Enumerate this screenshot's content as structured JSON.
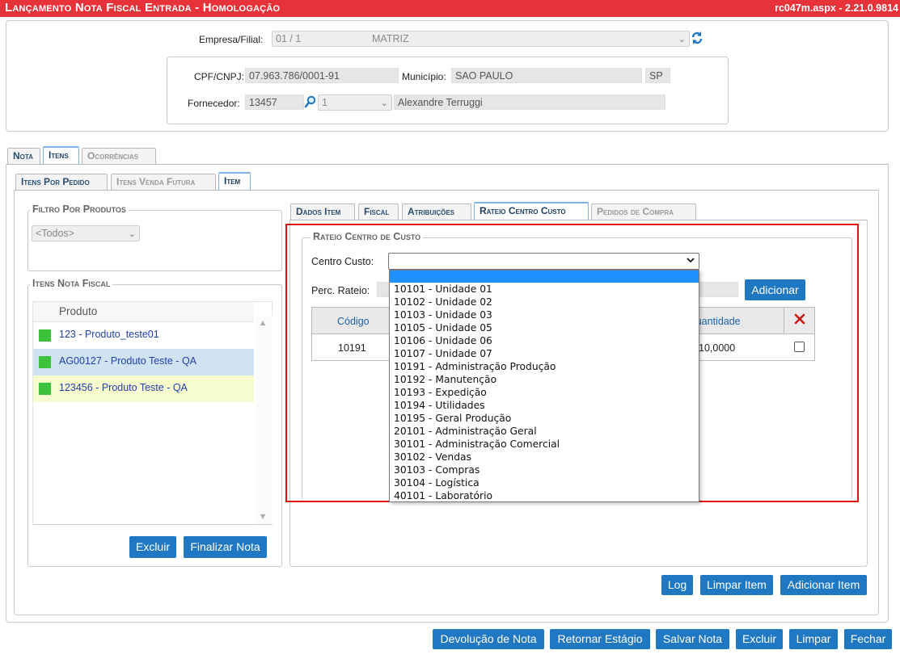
{
  "header": {
    "title": "Lançamento Nota Fiscal Entrada  - Homologação",
    "version": "rc047m.aspx - 2.21.0.9814"
  },
  "empresa": {
    "label": "Empresa/Filial:",
    "code": "01 / 1",
    "name": "MATRIZ"
  },
  "fornecedor_box": {
    "cpf_label": "CPF/CNPJ:",
    "cpf_value": "07.963.786/0001-91",
    "municipio_label": "Município:",
    "municipio_value": "SAO PAULO",
    "uf_value": "SP",
    "fornecedor_label": "Fornecedor:",
    "fornecedor_code": "13457",
    "fornecedor_select": "1",
    "fornecedor_name": "Alexandre Terruggi"
  },
  "main_tabs": [
    "Nota",
    "Itens",
    "Ocorrências"
  ],
  "sub_tabs": [
    "Itens Por Pedido",
    "Itens Venda Futura",
    "Item"
  ],
  "filtro": {
    "legend": "Filtro Por Produtos",
    "select_value": "<Todos>"
  },
  "itens_nota": {
    "legend": "Itens Nota Fiscal",
    "column": "Produto",
    "rows": [
      {
        "text": "123 - Produto_teste01"
      },
      {
        "text": "AG00127 - Produto Teste - QA"
      },
      {
        "text": "123456 - Produto Teste - QA"
      }
    ],
    "excluir_label": "Excluir",
    "finalizar_label": "Finalizar Nota"
  },
  "item_tabs": [
    "Dados Item",
    "Fiscal",
    "Atribuições",
    "Rateio Centro Custo",
    "Pedidos de Compra"
  ],
  "rateio": {
    "legend": "Rateio Centro de Custo",
    "centro_label": "Centro Custo:",
    "perc_label": "Perc. Rateio:",
    "adicionar_label": "Adicionar",
    "col_codigo": "Código",
    "col_quantidade": "Quantidade",
    "row_codigo": "10191",
    "row_quantidade": "10,0000",
    "options": [
      "10101 - Unidade 01",
      "10102 - Unidade 02",
      "10103 - Unidade 03",
      "10105 - Unidade 05",
      "10106 - Unidade 06",
      "10107 - Unidade 07",
      "10191 - Administração Produção",
      "10192 - Manutenção",
      "10193 - Expedição",
      "10194 - Utilidades",
      "10195 - Geral Produção",
      "20101 - Administração Geral",
      "30101 - Administração Comercial",
      "30102 - Vendas",
      "30103 - Compras",
      "30104 - Logística",
      "40101 - Laboratório"
    ]
  },
  "item_actions": {
    "log": "Log",
    "limpar_item": "Limpar Item",
    "adicionar_item": "Adicionar Item"
  },
  "footer": {
    "devolucao": "Devolução de Nota",
    "retornar": "Retornar Estágio",
    "salvar": "Salvar Nota",
    "excluir": "Excluir",
    "limpar": "Limpar",
    "fechar": "Fechar"
  },
  "colors": {
    "header_bg": "#e8323a",
    "button_bg": "#1f78c1",
    "highlight_border": "#e01010",
    "status_green": "#3cc23c",
    "row_selected": "#cfe3f3",
    "row_alt": "#f7fccf"
  }
}
